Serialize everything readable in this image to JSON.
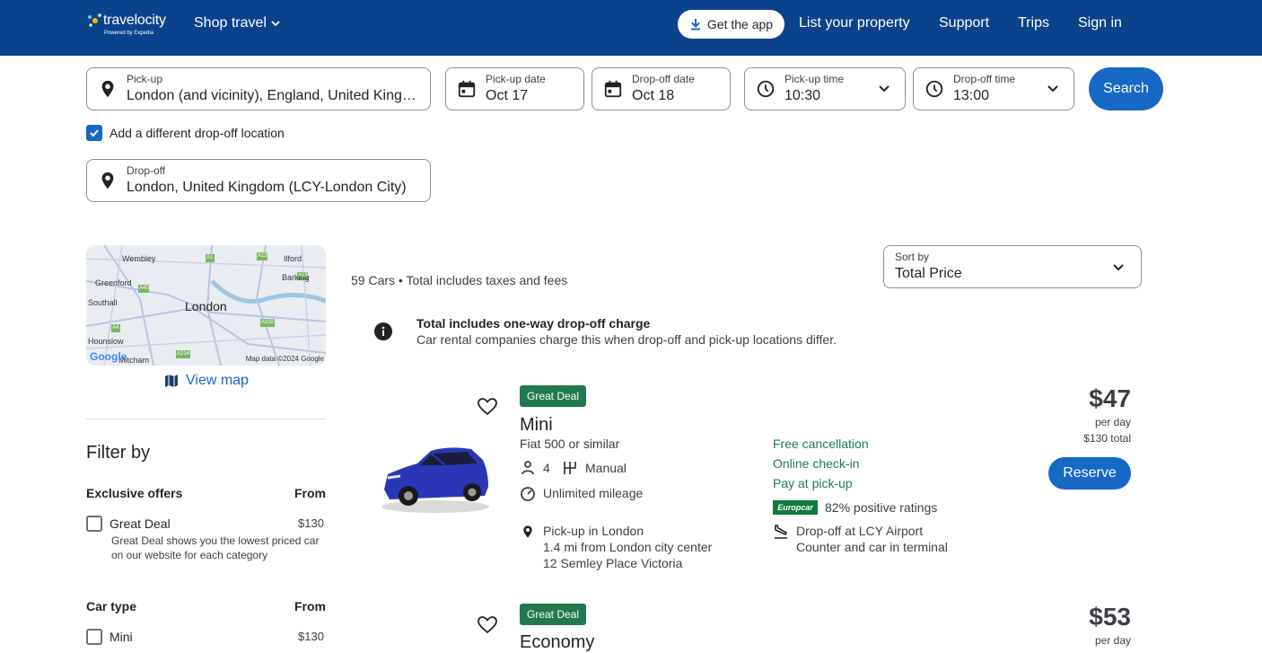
{
  "header": {
    "logo_text": "travelocity",
    "logo_sub": "Powered by Expedia",
    "shop_travel": "Shop travel",
    "get_app": "Get the app",
    "list_property": "List your property",
    "support": "Support",
    "trips": "Trips",
    "sign_in": "Sign in"
  },
  "search": {
    "pickup_label": "Pick-up",
    "pickup_value": "London (and vicinity), England, United Kingdom",
    "pickup_date_label": "Pick-up date",
    "pickup_date_value": "Oct 17",
    "dropoff_date_label": "Drop-off date",
    "dropoff_date_value": "Oct 18",
    "pickup_time_label": "Pick-up time",
    "pickup_time_value": "10:30",
    "dropoff_time_label": "Drop-off time",
    "dropoff_time_value": "13:00",
    "search_button": "Search",
    "different_dropoff_label": "Add a different drop-off location",
    "different_dropoff_checked": true,
    "dropoff_label": "Drop-off",
    "dropoff_value": "London, United Kingdom (LCY-London City)"
  },
  "map": {
    "labels": [
      "Wembley",
      "Ilford",
      "Greenford",
      "Barking",
      "Southall",
      "London",
      "Hounslow",
      "Mitcham"
    ],
    "road_labels": [
      "A1",
      "A12",
      "A40",
      "A13",
      "A102",
      "A4",
      "A214"
    ],
    "attribution": "Map data ©2024 Google",
    "google": "Google",
    "view_map": "View map"
  },
  "filters": {
    "title": "Filter by",
    "exclusive": {
      "title": "Exclusive offers",
      "from": "From",
      "option_label": "Great Deal",
      "option_price": "$130",
      "option_desc": "Great Deal shows you the lowest priced car on our website for each category"
    },
    "car_type": {
      "title": "Car type",
      "from": "From",
      "option_label": "Mini",
      "option_price": "$130"
    }
  },
  "results": {
    "count_text": "59 Cars • Total includes taxes and fees",
    "sort_label": "Sort by",
    "sort_value": "Total Price",
    "notice_title": "Total includes one-way drop-off charge",
    "notice_text": "Car rental companies charge this when drop-off and pick-up locations differ.",
    "cars": [
      {
        "badge": "Great Deal",
        "name": "Mini",
        "similar": "Fiat 500 or similar",
        "seats": "4",
        "transmission": "Manual",
        "mileage": "Unlimited mileage",
        "pickup_title": "Pick-up in London",
        "pickup_distance": "1.4 mi from London city center",
        "pickup_address": "12 Semley Place Victoria",
        "free_cancel": "Free cancellation",
        "online_checkin": "Online check-in",
        "pay_at_pickup": "Pay at pick-up",
        "vendor": "Europcar",
        "rating": "82% positive ratings",
        "dropoff_title": "Drop-off at LCY Airport",
        "dropoff_desc": "Counter and car in terminal",
        "price": "$47",
        "per_day": "per day",
        "total": "$130 total",
        "reserve": "Reserve"
      },
      {
        "badge": "Great Deal",
        "name": "Economy",
        "price": "$53",
        "per_day": "per day"
      }
    ]
  },
  "colors": {
    "header_bg": "#0a438b",
    "primary": "#1668c4",
    "deal_green": "#227950"
  }
}
